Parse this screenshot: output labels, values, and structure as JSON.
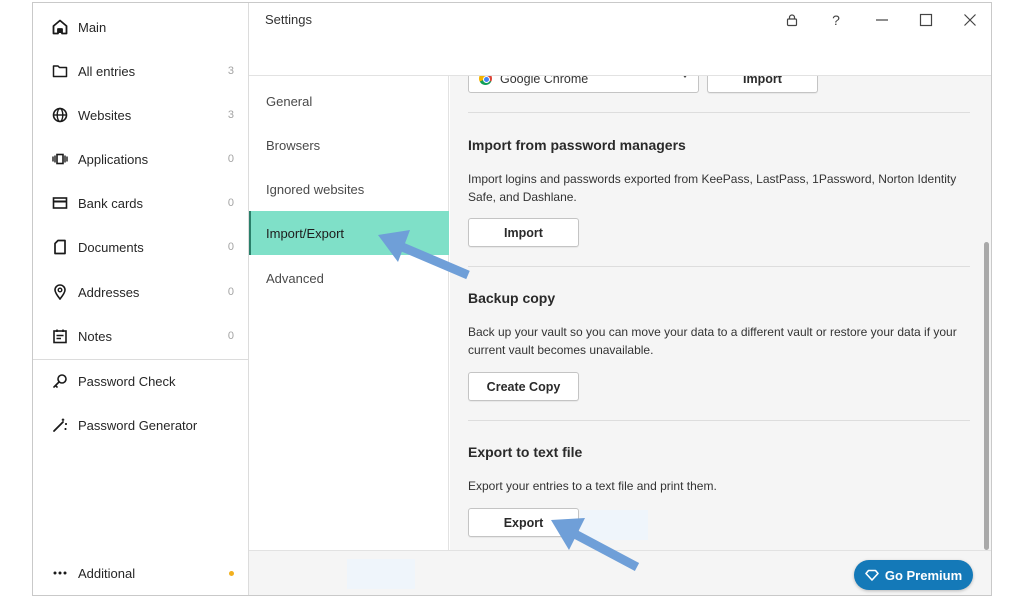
{
  "sidebar": {
    "items": [
      {
        "label": "Main",
        "icon": "home-icon",
        "count": ""
      },
      {
        "label": "All entries",
        "icon": "folder-icon",
        "count": "3"
      },
      {
        "label": "Websites",
        "icon": "globe-icon",
        "count": "3"
      },
      {
        "label": "Applications",
        "icon": "applications-icon",
        "count": "0"
      },
      {
        "label": "Bank cards",
        "icon": "card-icon",
        "count": "0"
      },
      {
        "label": "Documents",
        "icon": "document-icon",
        "count": "0"
      },
      {
        "label": "Addresses",
        "icon": "location-pin-icon",
        "count": "0"
      },
      {
        "label": "Notes",
        "icon": "notes-icon",
        "count": "0"
      }
    ],
    "tools": [
      {
        "label": "Password Check",
        "icon": "key-icon"
      },
      {
        "label": "Password Generator",
        "icon": "magic-wand-icon"
      }
    ],
    "additional": {
      "label": "Additional",
      "icon": "more-dots-icon",
      "indicator_color": "#f2b01e"
    }
  },
  "header": {
    "title": "Settings",
    "controls": [
      "lock-icon",
      "help-icon",
      "minimize-icon",
      "maximize-icon",
      "close-icon"
    ],
    "help_label": "?"
  },
  "settings_nav": {
    "items": [
      {
        "label": "General",
        "active": false
      },
      {
        "label": "Browsers",
        "active": false
      },
      {
        "label": "Ignored websites",
        "active": false
      },
      {
        "label": "Import/Export",
        "active": true
      },
      {
        "label": "Advanced",
        "active": false
      }
    ],
    "active_color": "#7fe0c8"
  },
  "content": {
    "browser_import": {
      "selected_browser": "Google Chrome",
      "button_label": "Import"
    },
    "password_managers": {
      "title": "Import from password managers",
      "description": "Import logins and passwords exported from KeePass, LastPass, 1Password, Norton Identity Safe, and Dashlane.",
      "button_label": "Import"
    },
    "backup": {
      "title": "Backup copy",
      "description": "Back up your vault so you can move your data to a different vault or restore your data if your current vault becomes unavailable.",
      "button_label": "Create Copy"
    },
    "export": {
      "title": "Export to text file",
      "description": "Export your entries to a text file and print them.",
      "button_label": "Export"
    }
  },
  "footer": {
    "premium_label": "Go Premium",
    "premium_color": "#1479b8"
  },
  "annotations": {
    "arrow_color": "#6f9fd8"
  }
}
